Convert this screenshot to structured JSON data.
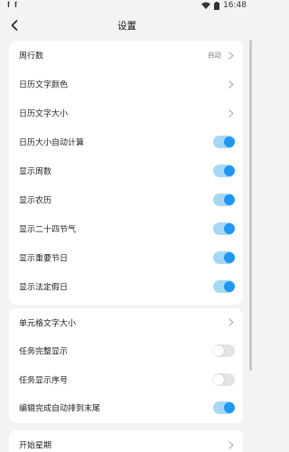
{
  "status_bar": {
    "left_text": "𝐟 𝐟",
    "time": "16:48"
  },
  "header": {
    "title": "设置"
  },
  "group1": [
    {
      "label": "周行数",
      "type": "value",
      "value": "自动"
    },
    {
      "label": "日历文字颜色",
      "type": "nav"
    },
    {
      "label": "日历文字大小",
      "type": "nav"
    },
    {
      "label": "日历大小自动计算",
      "type": "toggle",
      "on": true
    },
    {
      "label": "显示周数",
      "type": "toggle",
      "on": true
    },
    {
      "label": "显示农历",
      "type": "toggle",
      "on": true
    },
    {
      "label": "显示二十四节气",
      "type": "toggle",
      "on": true
    },
    {
      "label": "显示重要节日",
      "type": "toggle",
      "on": true
    },
    {
      "label": "显示法定假日",
      "type": "toggle",
      "on": true
    }
  ],
  "group2": [
    {
      "label": "单元格文字大小",
      "type": "nav"
    },
    {
      "label": "任务完整显示",
      "type": "toggle",
      "on": false
    },
    {
      "label": "任务显示序号",
      "type": "toggle",
      "on": false
    },
    {
      "label": "编辑完成自动排到末尾",
      "type": "toggle",
      "on": true
    }
  ],
  "group3": [
    {
      "label": "开始星期",
      "type": "nav"
    }
  ],
  "colors": {
    "accent": "#2196f3",
    "track_on": "#a6d8f6",
    "track_off": "#e3e3e6",
    "background": "#f2f3f5"
  }
}
